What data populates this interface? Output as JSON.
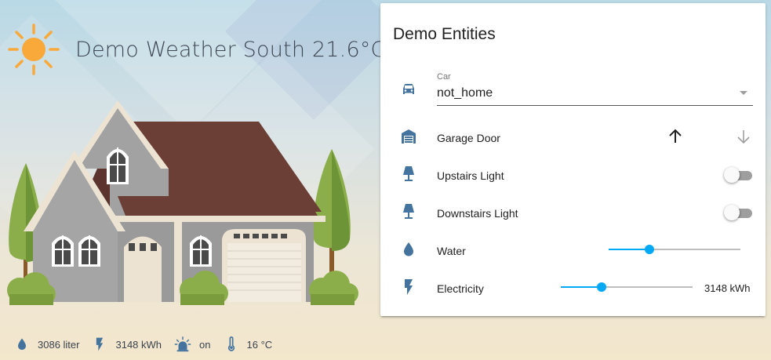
{
  "weather": {
    "title": "Demo Weather South 21.6°C",
    "icon": "sun-icon",
    "icon_color": "#f9a83a"
  },
  "status_bar": [
    {
      "icon": "water-drop-icon",
      "text": "3086 liter"
    },
    {
      "icon": "flash-icon",
      "text": "3148 kWh"
    },
    {
      "icon": "alarm-light-icon",
      "text": "on"
    },
    {
      "icon": "thermometer-icon",
      "text": "16 °C"
    }
  ],
  "card": {
    "title": "Demo Entities",
    "car": {
      "label": "Car",
      "value": "not_home",
      "icon": "car-icon"
    },
    "garage": {
      "label": "Garage Door",
      "icon": "garage-icon",
      "open_icon": "arrow-up-icon",
      "close_icon": "arrow-down-icon"
    },
    "upstairs": {
      "label": "Upstairs Light",
      "icon": "lamp-icon",
      "state": "off"
    },
    "downstairs": {
      "label": "Downstairs Light",
      "icon": "lamp-icon",
      "state": "off"
    },
    "water": {
      "label": "Water",
      "icon": "water-drop-icon",
      "level": 0.31
    },
    "electricity": {
      "label": "Electricity",
      "icon": "flash-icon",
      "level": 0.31,
      "value": "3148 kWh"
    }
  },
  "colors": {
    "icon": "#44739e",
    "accent": "#03a9f4",
    "text": "#212121"
  }
}
